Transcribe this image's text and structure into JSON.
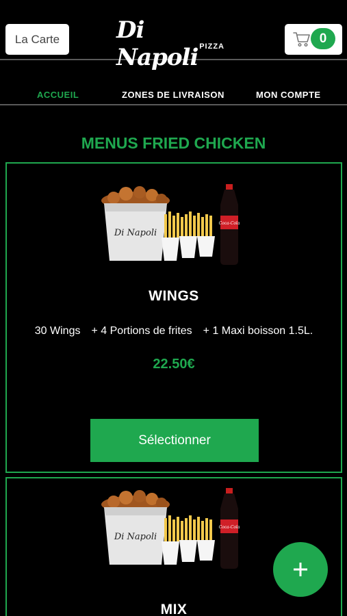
{
  "header": {
    "menu_button_label": "La Carte",
    "logo_text": "Di Napoli",
    "logo_subtext": "PIZZA",
    "cart_count": "0"
  },
  "nav": {
    "items": [
      {
        "label": "ACCUEIL",
        "active": true
      },
      {
        "label": "ZONES DE LIVRAISON",
        "active": false
      },
      {
        "label": "MON COMPTE",
        "active": false
      }
    ]
  },
  "section_title": "MENUS FRIED CHICKEN",
  "products": [
    {
      "name": "WINGS",
      "description": [
        "30 Wings",
        "+ 4 Portions de frites",
        "+ 1 Maxi boisson 1.5L."
      ],
      "price": "22.50€",
      "button_label": "Sélectionner",
      "bucket_label": "Di Napoli",
      "bottle_label": "Coca-Cola"
    },
    {
      "name": "MIX",
      "bucket_label": "Di Napoli",
      "bottle_label": "Coca-Cola"
    }
  ],
  "fab_icon": "plus-icon",
  "colors": {
    "accent": "#1fa84f",
    "background": "#000000",
    "button_bg": "#ffffff"
  }
}
